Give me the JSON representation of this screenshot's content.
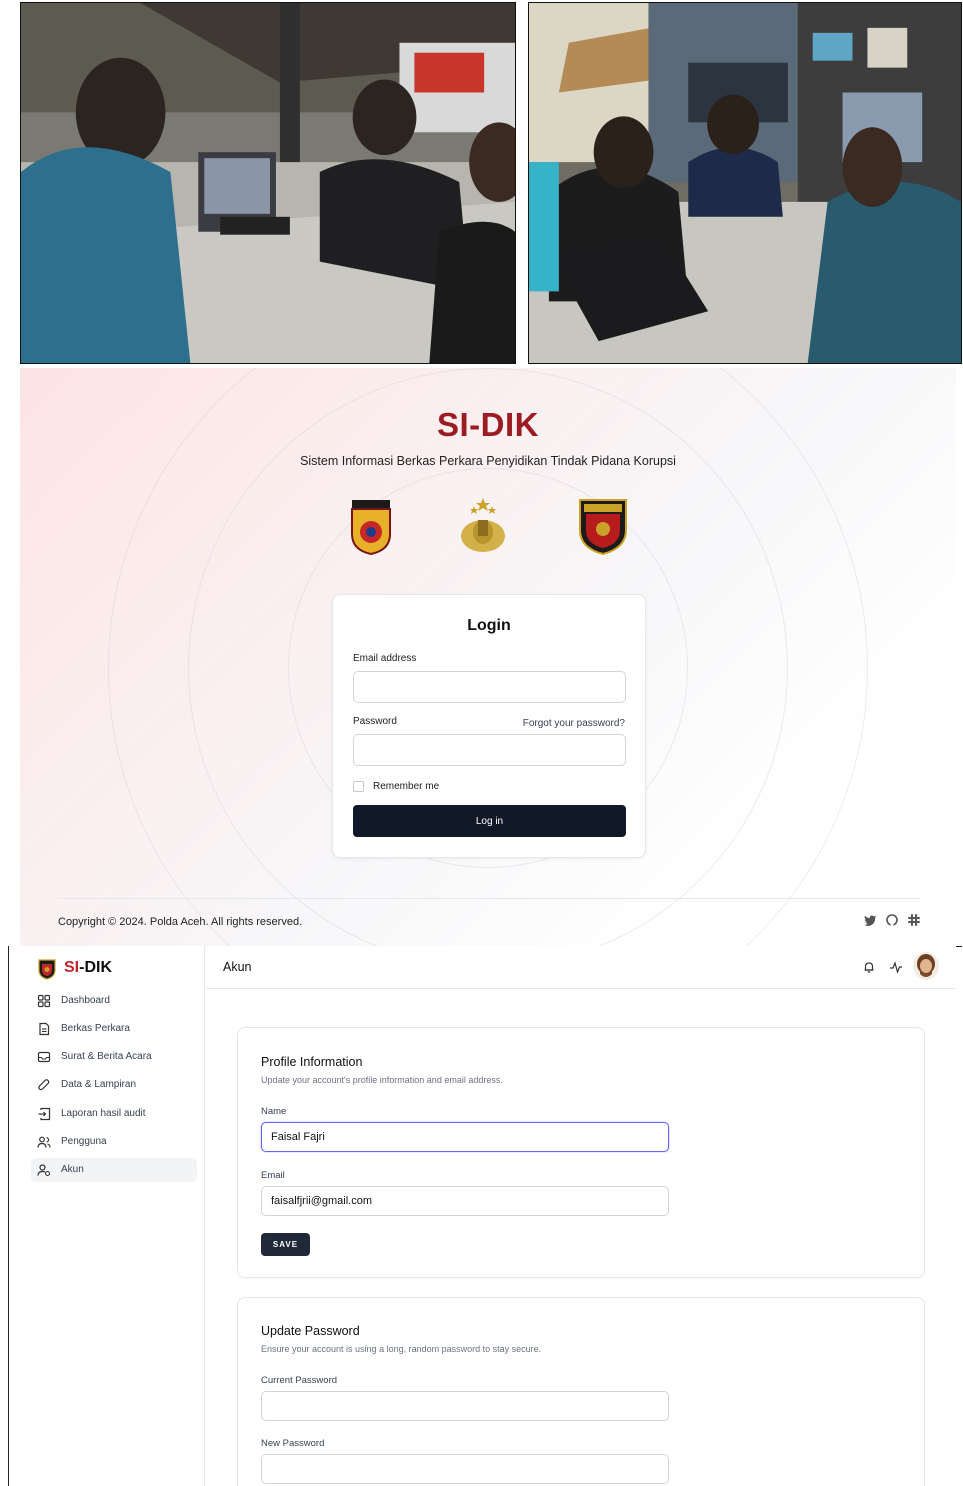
{
  "login": {
    "brand_title": "SI-DIK",
    "brand_subtitle": "Sistem Informasi Berkas Perkara Penyidikan Tindak Pidana Korupsi",
    "card_title": "Login",
    "email_label": "Email address",
    "password_label": "Password",
    "forgot_link": "Forgot your password?",
    "remember_label": "Remember me",
    "login_button": "Log in",
    "copyright": "Copyright © 2024. Polda Aceh. All rights reserved.",
    "social_icons": [
      "twitter-icon",
      "github-icon",
      "slack-icon"
    ]
  },
  "app": {
    "name_si": "SI",
    "name_dik": "-DIK",
    "page_title": "Akun",
    "sidebar": [
      {
        "label": "Dashboard",
        "icon": "dashboard-icon"
      },
      {
        "label": "Berkas Perkara",
        "icon": "file-icon"
      },
      {
        "label": "Surat & Berita Acara",
        "icon": "inbox-icon"
      },
      {
        "label": "Data & Lampiran",
        "icon": "paperclip-icon"
      },
      {
        "label": "Laporan hasil audit",
        "icon": "report-icon"
      },
      {
        "label": "Pengguna",
        "icon": "users-icon"
      },
      {
        "label": "Akun",
        "icon": "user-settings-icon",
        "active": true
      }
    ],
    "top_icons": [
      "bell-icon",
      "activity-icon"
    ]
  },
  "profile": {
    "title": "Profile Information",
    "subtitle": "Update your account's profile information and email address.",
    "name_label": "Name",
    "name_value": "Faisal Fajri",
    "email_label": "Email",
    "email_value": "faisalfjrii@gmail.com",
    "save_button": "SAVE"
  },
  "password": {
    "title": "Update Password",
    "subtitle": "Ensure your account is using a long, random password to stay secure.",
    "current_label": "Current Password",
    "new_label": "New Password"
  },
  "colors": {
    "brand_red": "#9b1c22",
    "button_dark": "#111827",
    "focus_ring": "#6366f1"
  }
}
